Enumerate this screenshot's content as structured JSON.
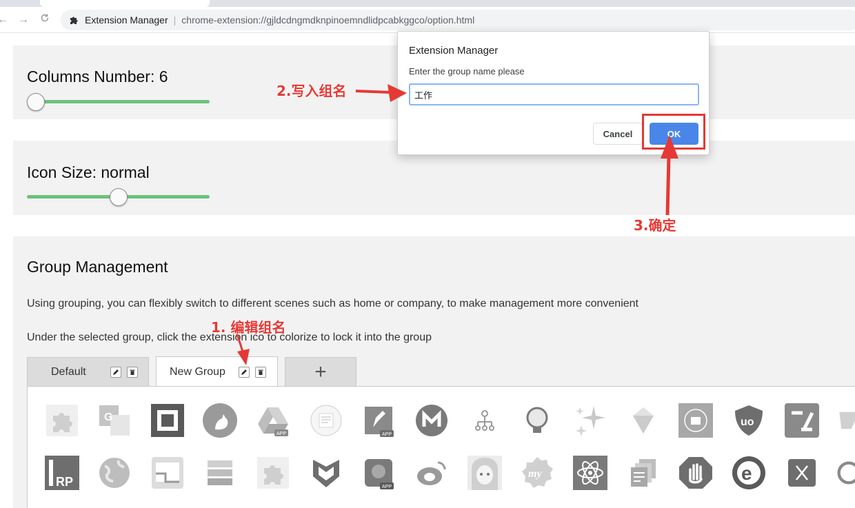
{
  "browser": {
    "back_icon": "arrow-left-icon",
    "forward_icon": "arrow-right-icon",
    "reload_icon": "reload-icon",
    "site_name": "Extension Manager",
    "url": "chrome-extension://gjldcdngmdknpinoemndlidpcabkggco/option.html"
  },
  "columns": {
    "title": "Columns Number: 6",
    "level": 0.0
  },
  "icon_size": {
    "title": "Icon Size: normal",
    "level": 0.5
  },
  "group_management": {
    "title": "Group Management",
    "description_1": "Using grouping, you can flexibly switch to different scenes such as home or company, to make management more convenient",
    "description_2": "Under the selected group, click the extension ico to colorize to lock it into the group",
    "tabs": [
      {
        "label": "Default",
        "active": false
      },
      {
        "label": "New Group",
        "active": true
      }
    ],
    "add_tab_label": "+",
    "edit_icon": "pencil-icon",
    "delete_icon": "trash-icon"
  },
  "dialog": {
    "title": "Extension Manager",
    "message": "Enter the group name please",
    "input_value": "工作",
    "cancel_label": "Cancel",
    "ok_label": "OK"
  },
  "annotations": {
    "step1": "1. 编辑组名",
    "step2": "2.写入组名",
    "step3": "3.确定"
  },
  "colors": {
    "accent": "#4a86e8",
    "slider": "#6cc27b",
    "annotation": "#e53935",
    "panel": "#f2f2f2"
  }
}
